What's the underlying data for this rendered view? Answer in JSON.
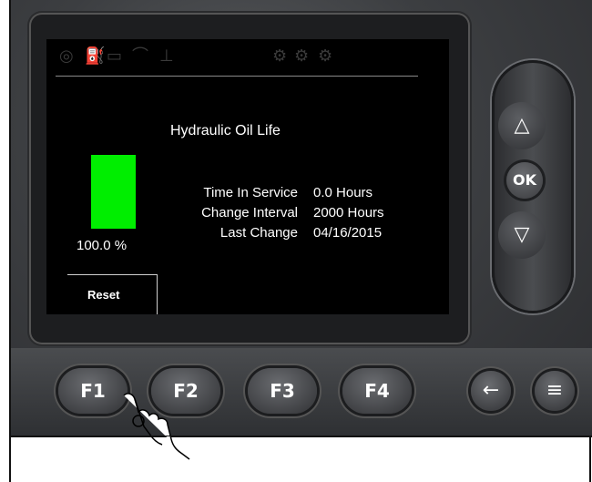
{
  "status_icons": [
    "radio-icon",
    "fuel-icon",
    "battery-icon",
    "oil-can-icon",
    "water-temp-icon",
    "engine-icon-1",
    "engine-icon-2",
    "engine-icon-3"
  ],
  "screen": {
    "title": "Hydraulic Oil Life",
    "gauge": {
      "level_percent": 100,
      "color": "#00ee00"
    },
    "percent_text": "100.0 %",
    "rows": [
      {
        "label": "Time In Service",
        "value": "0.0 Hours"
      },
      {
        "label": "Change Interval",
        "value": "2000 Hours"
      },
      {
        "label": "Last Change",
        "value": "04/16/2015"
      }
    ],
    "softkey_label": "Reset"
  },
  "nav": {
    "up": "△",
    "ok": "OK",
    "down": "▽"
  },
  "function_keys": [
    "F1",
    "F2",
    "F3",
    "F4"
  ],
  "round_keys": {
    "back": "←",
    "menu": "≡"
  }
}
